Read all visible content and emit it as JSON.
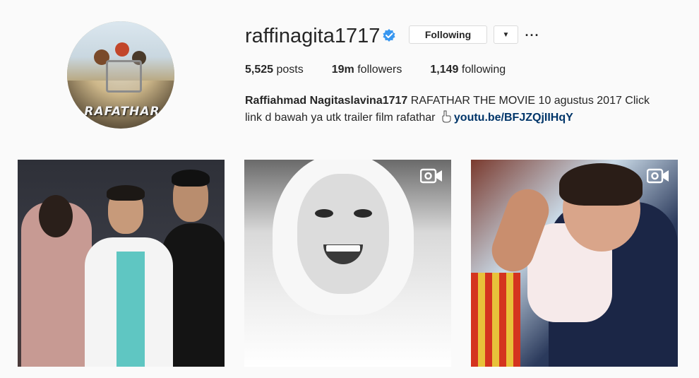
{
  "profile": {
    "username": "raffinagita1717",
    "verified": true,
    "avatar_text": "RAFATHAR",
    "following_button": "Following",
    "more_options": "···",
    "stats": {
      "posts_count": "5,525",
      "posts_label": "posts",
      "followers_count": "19m",
      "followers_label": "followers",
      "following_count": "1,149",
      "following_label": "following"
    },
    "bio": {
      "name": "Raffiahmad Nagitaslavina1717",
      "text_line": " RAFATHAR THE MOVIE 10 agustus 2017 Click link d bawah ya utk trailer film rafathar ",
      "link": "youtu.be/BFJZQjIIHqY"
    }
  },
  "posts": [
    {
      "type": "photo",
      "video_icon": false
    },
    {
      "type": "video",
      "video_icon": true,
      "icon": "video-icon"
    },
    {
      "type": "video",
      "video_icon": true,
      "icon": "video-icon"
    }
  ],
  "colors": {
    "verified_blue": "#3897f0",
    "link_color": "#003569",
    "background": "#fafafa"
  }
}
